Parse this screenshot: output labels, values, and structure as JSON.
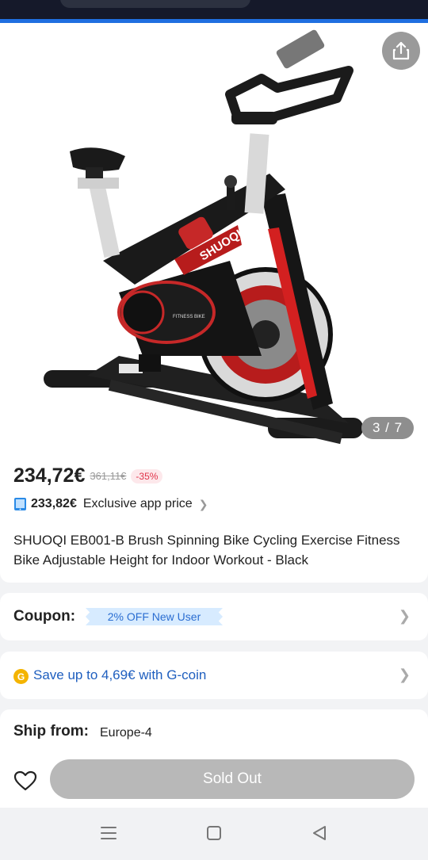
{
  "gallery": {
    "counter": "3 / 7",
    "product_brand_text": "SHUOQI",
    "flywheel_text": "FITNESS BIKE"
  },
  "price": {
    "current": "234,72€",
    "original": "361,11€",
    "discount": "-35%"
  },
  "app_price": {
    "value": "233,82€",
    "label": "Exclusive app price",
    "icon": "phone-icon"
  },
  "product": {
    "title": "SHUOQI EB001-B Brush Spinning Bike Cycling Exercise Fitness Bike Adjustable Height for Indoor Workout - Black"
  },
  "coupon": {
    "label": "Coupon:",
    "tag": "2% OFF New User"
  },
  "gcoin": {
    "icon_letter": "G",
    "text": "Save up to 4,69€ with G-coin"
  },
  "shipping": {
    "label": "Ship from:",
    "value": "Europe-4"
  },
  "actions": {
    "sold_out": "Sold Out"
  },
  "colors": {
    "accent_blue": "#1f6fe0",
    "discount_red": "#e0334a",
    "coupon_bg": "#d7ebff",
    "gcoin_gold": "#f4b400",
    "button_disabled": "#b8b8b8"
  }
}
